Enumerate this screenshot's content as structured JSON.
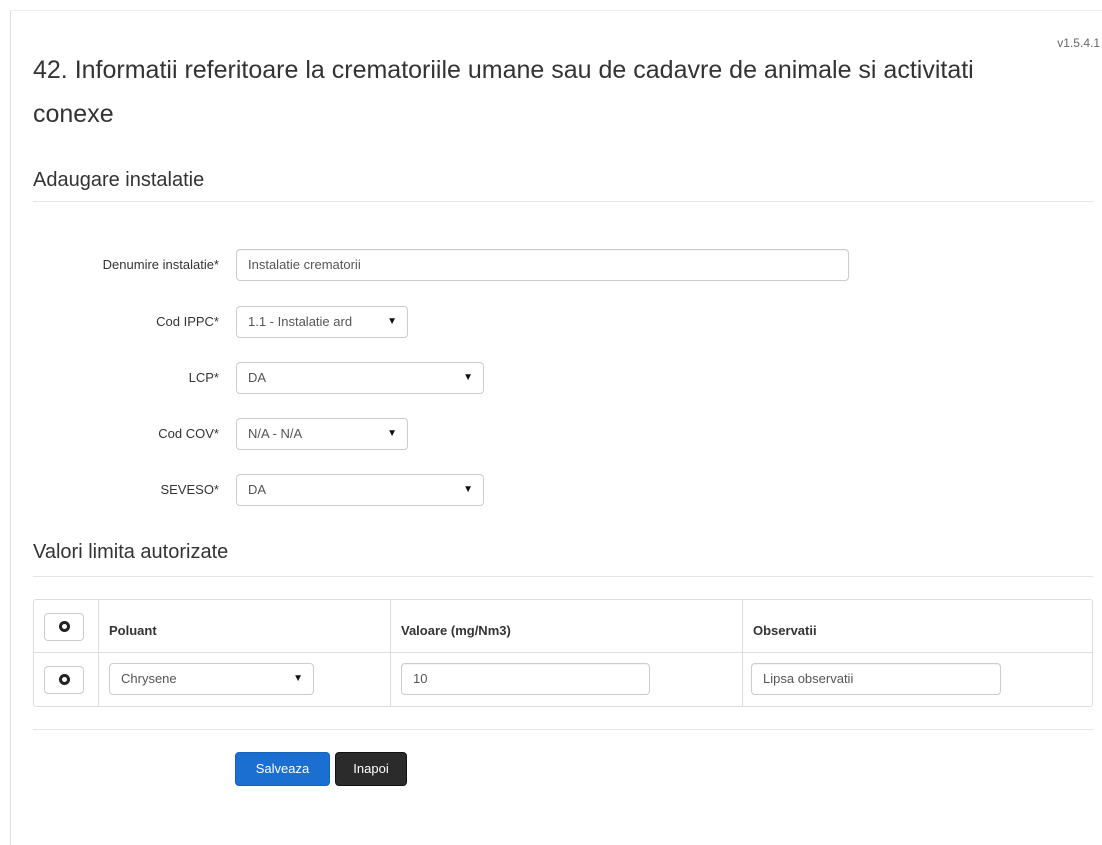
{
  "header": {
    "version": "v1.5.4.1",
    "title": "42. Informatii referitoare la crematoriile umane sau de cadavre de animale si activitati conexe"
  },
  "sections": {
    "add_installation": "Adaugare instalatie",
    "limit_values": "Valori limita autorizate"
  },
  "form": {
    "denumire": {
      "label": "Denumire instalatie*",
      "value": "Instalatie crematorii"
    },
    "cod_ippc": {
      "label": "Cod IPPC*",
      "value": "1.1 - Instalatie ard"
    },
    "lcp": {
      "label": "LCP*",
      "value": "DA"
    },
    "cod_cov": {
      "label": "Cod COV*",
      "value": "N/A - N/A"
    },
    "seveso": {
      "label": "SEVESO*",
      "value": "DA"
    }
  },
  "table": {
    "columns": [
      "Poluant",
      "Valoare (mg/Nm3)",
      "Observatii"
    ],
    "rows": [
      {
        "poluant": "Chrysene",
        "valoare": "10",
        "observatii": "Lipsa observatii"
      }
    ]
  },
  "buttons": {
    "save": "Salveaza",
    "back": "Inapoi"
  },
  "icons": {
    "add_row": "plus-circle-icon",
    "remove_row": "minus-circle-icon",
    "dropdown": "caret-down-icon"
  }
}
